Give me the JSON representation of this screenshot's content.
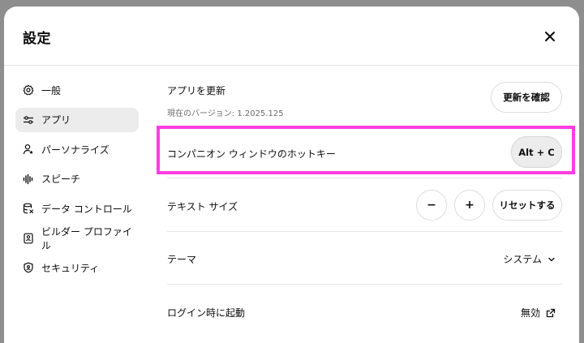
{
  "dialog": {
    "title": "設定"
  },
  "sidebar": {
    "items": [
      {
        "label": "一般",
        "icon": "gear-icon"
      },
      {
        "label": "アプリ",
        "icon": "sliders-icon"
      },
      {
        "label": "パーソナライズ",
        "icon": "person-icon"
      },
      {
        "label": "スピーチ",
        "icon": "waveform-icon"
      },
      {
        "label": "データ コントロール",
        "icon": "database-icon"
      },
      {
        "label": "ビルダー プロファイル",
        "icon": "id-card-icon"
      },
      {
        "label": "セキュリティ",
        "icon": "shield-icon"
      }
    ],
    "active_index": 1
  },
  "settings": {
    "update": {
      "label": "アプリを更新",
      "version": "現在のバージョン: 1.2025.125",
      "button": "更新を確認"
    },
    "hotkey": {
      "label": "コンパニオン ウィンドウのホットキー",
      "value": "Alt + C"
    },
    "text_size": {
      "label": "テキスト サイズ",
      "decrease": "−",
      "increase": "+",
      "reset": "リセットする"
    },
    "theme": {
      "label": "テーマ",
      "value": "システム"
    },
    "login": {
      "label": "ログイン時に起動",
      "value": "無効"
    }
  },
  "colors": {
    "highlight": "#ff3ee0",
    "backdrop": "#8e8e8e",
    "active_nav": "#ececec"
  }
}
